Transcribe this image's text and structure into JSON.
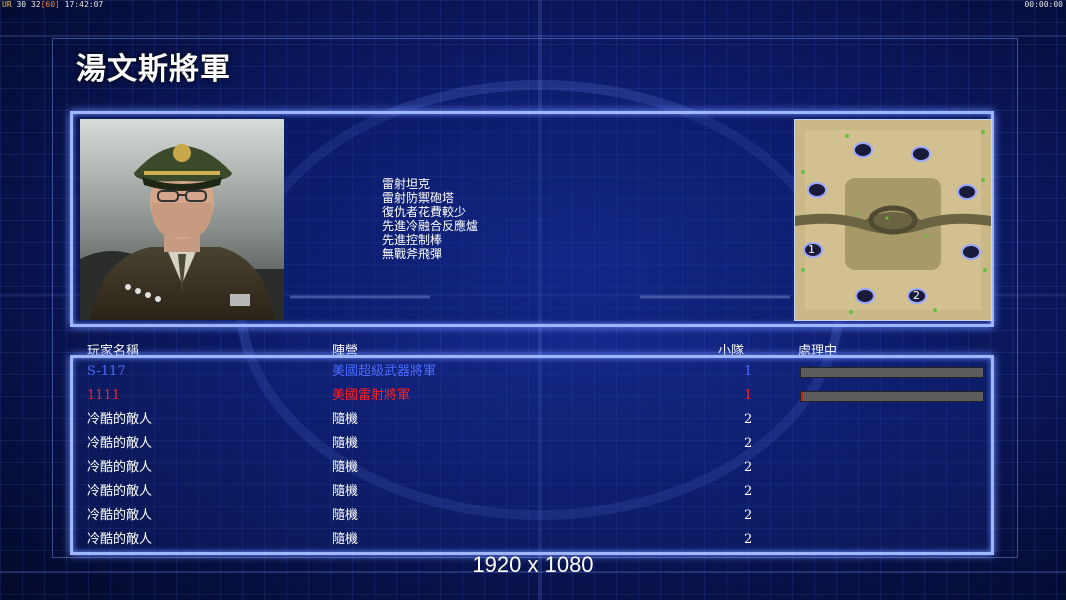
{
  "hud": {
    "fps_label": "UR",
    "fps_value": "30",
    "fps_extra": "32",
    "fps_cap": "[60]",
    "clock": "17:42:07",
    "timer": "00:00:00"
  },
  "title": "湯文斯將軍",
  "general": {
    "unit_list": [
      "雷射坦克",
      "雷射防禦砲塔",
      "復仇者花費較少",
      "先進冷融合反應爐",
      "先進控制棒",
      "無戰斧飛彈"
    ]
  },
  "minimap": {
    "start_positions": [
      "1",
      "2"
    ]
  },
  "table": {
    "headers": {
      "name": "玩家名稱",
      "faction": "陣營",
      "team": "小隊",
      "progress": "處理中"
    },
    "rows": [
      {
        "name": "S-117",
        "faction": "美國超級武器將軍",
        "team": "1",
        "color": "#4a6cff",
        "progress": 0.0
      },
      {
        "name": "1111",
        "faction": "美國雷射將軍",
        "team": "1",
        "color": "#ff2020",
        "progress": 0.01
      },
      {
        "name": "冷酷的敵人",
        "faction": "隨機",
        "team": "2",
        "color": "#ffffff"
      },
      {
        "name": "冷酷的敵人",
        "faction": "隨機",
        "team": "2",
        "color": "#ffffff"
      },
      {
        "name": "冷酷的敵人",
        "faction": "隨機",
        "team": "2",
        "color": "#ffffff"
      },
      {
        "name": "冷酷的敵人",
        "faction": "隨機",
        "team": "2",
        "color": "#ffffff"
      },
      {
        "name": "冷酷的敵人",
        "faction": "隨機",
        "team": "2",
        "color": "#ffffff"
      },
      {
        "name": "冷酷的敵人",
        "faction": "隨機",
        "team": "2",
        "color": "#ffffff"
      }
    ]
  },
  "resolution": "1920 x 1080"
}
